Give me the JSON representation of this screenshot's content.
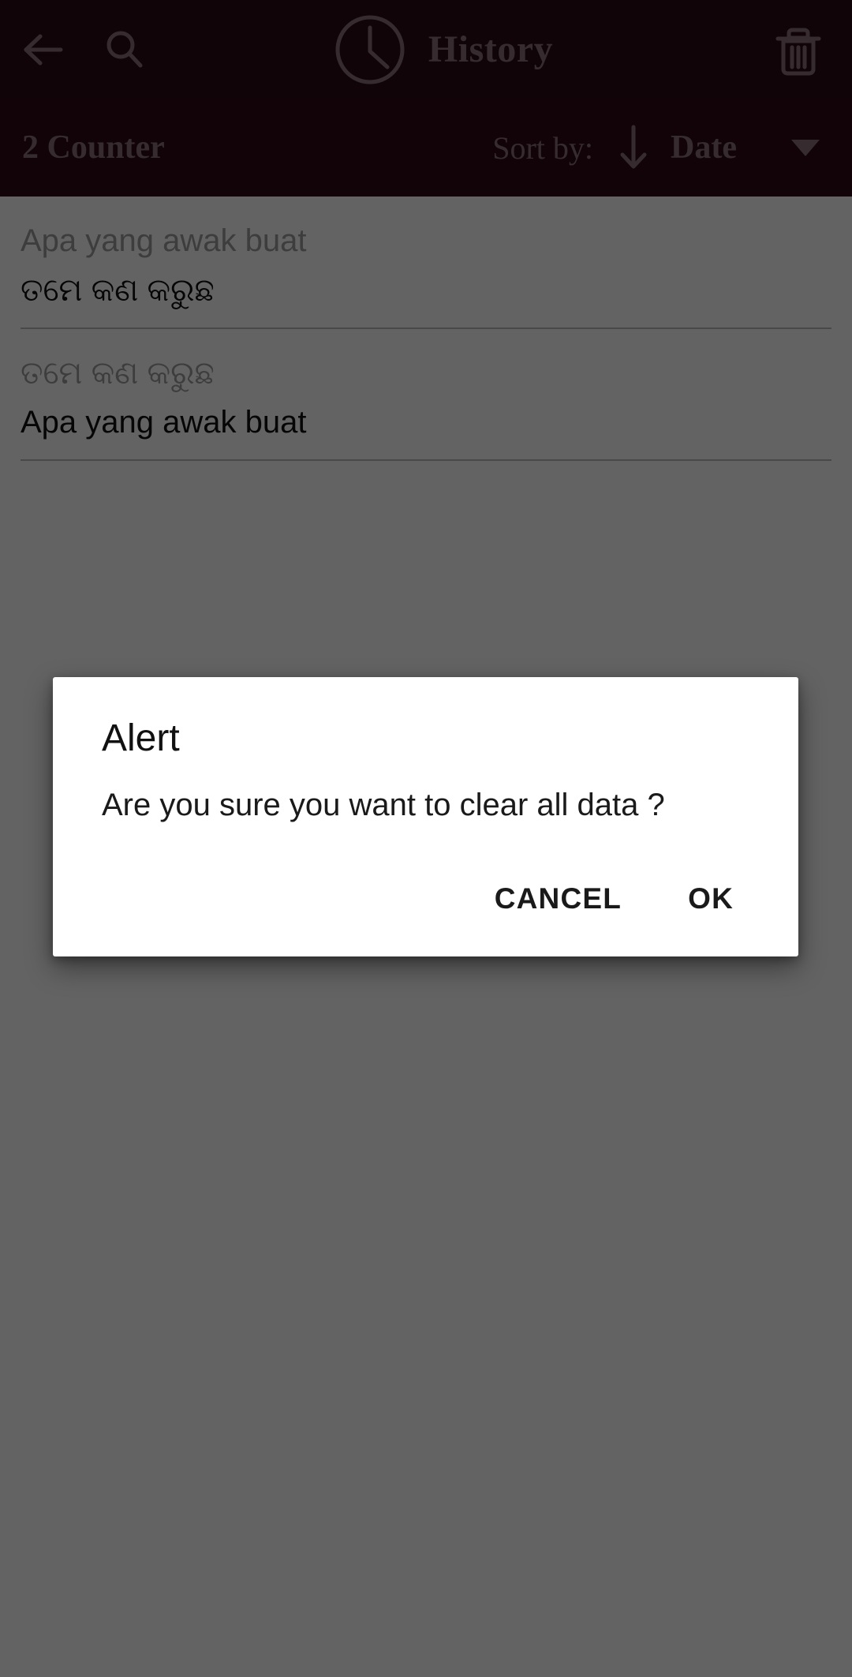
{
  "appbar": {
    "title": "History",
    "back_icon": "arrow-left-icon",
    "search_icon": "search-icon",
    "clock_icon": "clock-icon",
    "delete_icon": "trash-icon",
    "background_color": "#2e0c17",
    "foreground_color": "#8c7379"
  },
  "sortbar": {
    "counter_label": "2 Counter",
    "sort_by_label": "Sort by:",
    "sort_direction_icon": "arrow-down-icon",
    "sort_field": "Date",
    "dropdown_icon": "triangle-down-icon",
    "background_color": "#2d0a15"
  },
  "history": {
    "items": [
      {
        "source": "Apa yang awak buat",
        "target": "ତମେ କଣ କରୁଛ"
      },
      {
        "source": "ତମେ କଣ କରୁଛ",
        "target": "Apa yang awak buat"
      }
    ]
  },
  "dialog": {
    "title": "Alert",
    "message": "Are you sure you want to clear all data ?",
    "cancel_label": "CANCEL",
    "ok_label": "OK"
  }
}
